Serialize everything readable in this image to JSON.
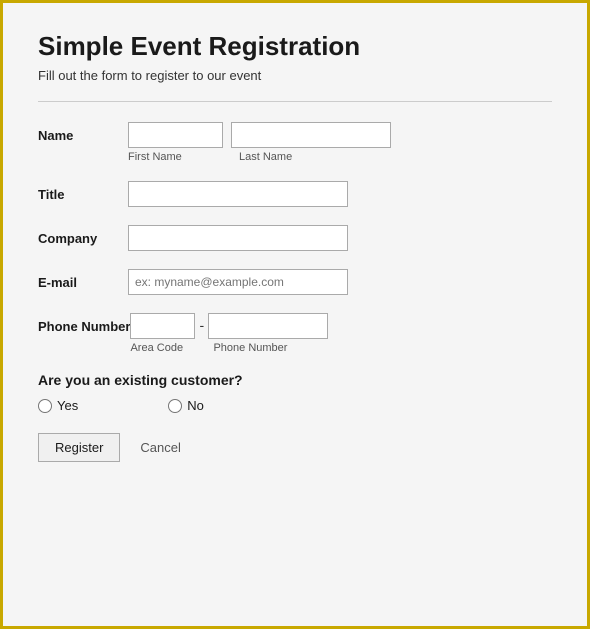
{
  "page": {
    "title": "Simple Event Registration",
    "subtitle": "Fill out the form to register to our event"
  },
  "form": {
    "name_label": "Name",
    "first_name_placeholder": "",
    "last_name_placeholder": "",
    "first_name_sublabel": "First Name",
    "last_name_sublabel": "Last Name",
    "title_label": "Title",
    "title_placeholder": "",
    "company_label": "Company",
    "company_placeholder": "",
    "email_label": "E-mail",
    "email_placeholder": "ex: myname@example.com",
    "phone_label": "Phone Number",
    "area_code_placeholder": "",
    "phone_number_placeholder": "",
    "area_code_sublabel": "Area Code",
    "phone_number_sublabel": "Phone Number",
    "customer_question": "Are you an existing customer?",
    "yes_label": "Yes",
    "no_label": "No",
    "register_button": "Register",
    "cancel_button": "Cancel"
  }
}
